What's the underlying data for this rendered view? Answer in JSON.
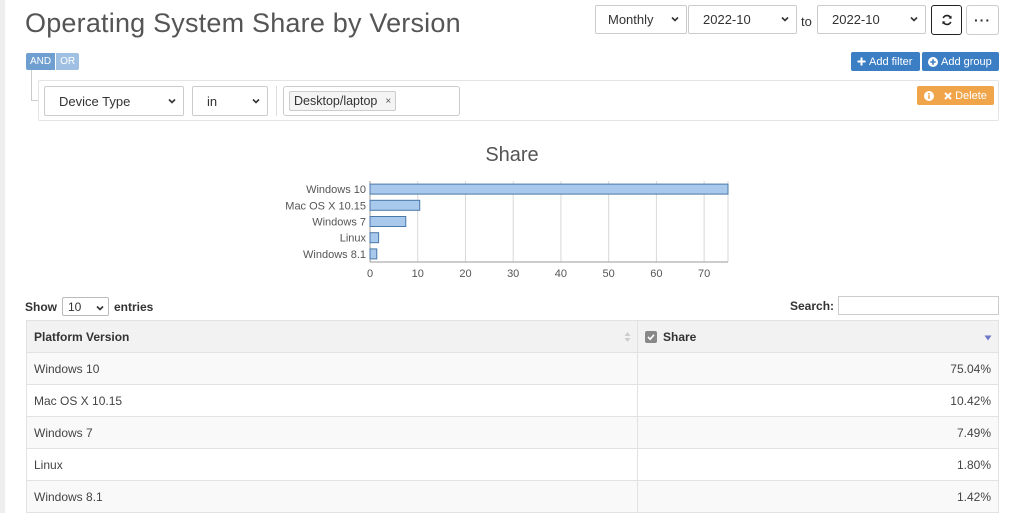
{
  "page": {
    "title": "Operating System Share by Version"
  },
  "toolbar": {
    "period": "Monthly",
    "from": "2022-10",
    "to_label": "to",
    "to": "2022-10",
    "more_label": "···"
  },
  "query": {
    "and_label": "AND",
    "or_label": "OR",
    "add_filter_label": "Add filter",
    "add_group_label": "Add group",
    "delete_label": "Delete",
    "filter": {
      "field": "Device Type",
      "operator": "in",
      "value": "Desktop/laptop",
      "remove_glyph": "×"
    }
  },
  "chart_data": {
    "type": "bar",
    "orientation": "horizontal",
    "title": "Share",
    "categories": [
      "Windows 10",
      "Mac OS X 10.15",
      "Windows 7",
      "Linux",
      "Windows 8.1"
    ],
    "values": [
      75.04,
      10.42,
      7.49,
      1.8,
      1.42
    ],
    "xlim": [
      0,
      75
    ],
    "xticks": [
      0,
      10,
      20,
      30,
      40,
      50,
      60,
      70
    ],
    "grid": true,
    "bar_color": "#a8c8ec",
    "bar_stroke": "#4a78a8"
  },
  "table": {
    "show_label": "Show",
    "entries_label": "entries",
    "page_length": "10",
    "search_label": "Search:",
    "columns": [
      "Platform Version",
      "Share"
    ],
    "rows": [
      {
        "version": "Windows 10",
        "share": "75.04%"
      },
      {
        "version": "Mac OS X 10.15",
        "share": "10.42%"
      },
      {
        "version": "Windows 7",
        "share": "7.49%"
      },
      {
        "version": "Linux",
        "share": "1.80%"
      },
      {
        "version": "Windows 8.1",
        "share": "1.42%"
      }
    ]
  },
  "icons": [
    "chevron-down-icon",
    "refresh-icon",
    "plus-icon",
    "plus-circle-icon",
    "info-icon",
    "close-icon",
    "sort-icon",
    "checkbox-icon"
  ],
  "colors": {
    "primary": "#3c7ec4",
    "warning": "#f0a54b",
    "andor": "#6f9fd0"
  }
}
